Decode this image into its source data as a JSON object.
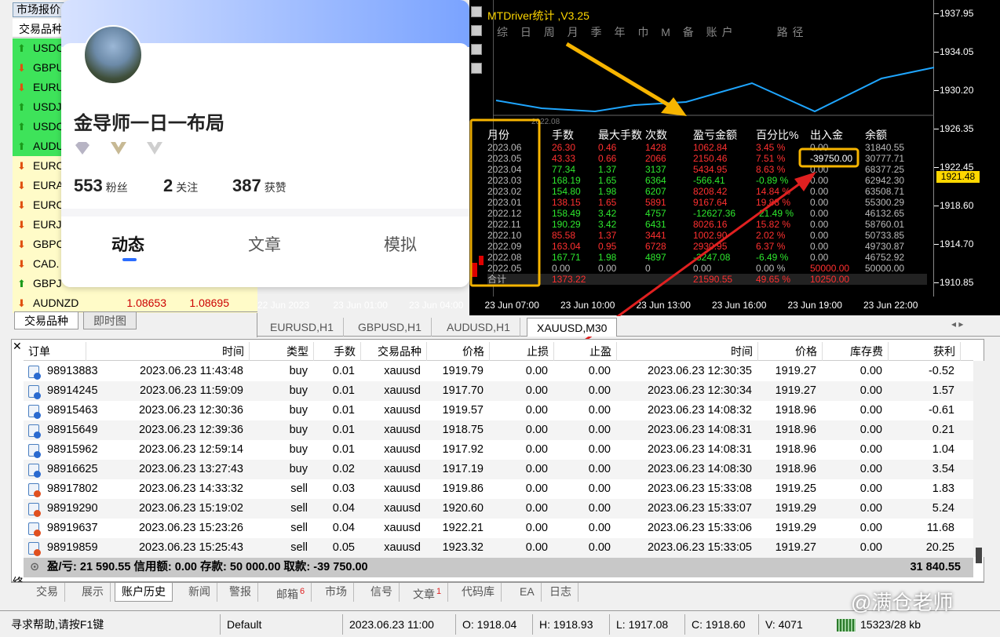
{
  "market_watch": {
    "title": "市场报价",
    "column_symbol": "交易品种",
    "rows": [
      {
        "symbol": "USDC",
        "dir": "up",
        "hl": "green"
      },
      {
        "symbol": "GBPU",
        "dir": "down",
        "hl": "green"
      },
      {
        "symbol": "EURU",
        "dir": "down",
        "hl": "green"
      },
      {
        "symbol": "USDJ",
        "dir": "up",
        "hl": "green"
      },
      {
        "symbol": "USDC",
        "dir": "up",
        "hl": "green"
      },
      {
        "symbol": "AUDU",
        "dir": "up",
        "hl": "green"
      },
      {
        "symbol": "EURC",
        "dir": "down",
        "hl": "yellow"
      },
      {
        "symbol": "EURA",
        "dir": "down",
        "hl": "yellow"
      },
      {
        "symbol": "EURC",
        "dir": "down",
        "hl": "yellow"
      },
      {
        "symbol": "EURJ",
        "dir": "down",
        "hl": "yellow"
      },
      {
        "symbol": "GBPC",
        "dir": "down",
        "hl": "yellow"
      },
      {
        "symbol": "CAD.",
        "dir": "down",
        "hl": "yellow"
      },
      {
        "symbol": "GBPJ",
        "dir": "up",
        "hl": "yellow"
      },
      {
        "symbol": "AUDNZD",
        "dir": "down",
        "hl": "yellow",
        "bid": "1.08653",
        "ask": "1.08695"
      }
    ],
    "tabs": [
      "交易品种",
      "即时图"
    ]
  },
  "chart": {
    "title": "MTDriver统计 ,V3.25",
    "periods": "综 日 周 月 季 年 巾 M 备 账户",
    "route": "路径",
    "prices": [
      "1937.95",
      "1934.05",
      "1930.20",
      "1926.35",
      "1922.45",
      "1918.60",
      "1914.70",
      "1910.85"
    ],
    "current_price": "1921.48",
    "times": [
      "22 Jun 2023",
      "23 Jun 01:00",
      "23 Jun 04:00",
      "23 Jun 07:00",
      "23 Jun 10:00",
      "23 Jun 13:00",
      "23 Jun 16:00",
      "23 Jun 19:00",
      "23 Jun 22:00"
    ],
    "date_label": "2022.08",
    "stats_headers": [
      "月份",
      "手数",
      "最大手数",
      "次数",
      "盈亏金额",
      "百分比%",
      "出入金",
      "余额"
    ],
    "stats_rows": [
      [
        "2023.06",
        "26.30",
        "0.46",
        "1428",
        "1062.84",
        "3.45 %",
        "0.00",
        "31840.55"
      ],
      [
        "2023.05",
        "43.33",
        "0.66",
        "2066",
        "2150.46",
        "7.51 %",
        "-39750.00",
        "30777.71"
      ],
      [
        "2023.04",
        "77.34",
        "1.37",
        "3137",
        "5434.95",
        "8.63 %",
        "0.00",
        "68377.25"
      ],
      [
        "2023.03",
        "168.19",
        "1.65",
        "6364",
        "-566.41",
        "-0.89 %",
        "0.00",
        "62942.30"
      ],
      [
        "2023.02",
        "154.80",
        "1.98",
        "6207",
        "8208.42",
        "14.84 %",
        "0.00",
        "63508.71"
      ],
      [
        "2023.01",
        "138.15",
        "1.65",
        "5891",
        "9167.64",
        "19.88 %",
        "0.00",
        "55300.29"
      ],
      [
        "2022.12",
        "158.49",
        "3.42",
        "4757",
        "-12627.36",
        "-21.49 %",
        "0.00",
        "46132.65"
      ],
      [
        "2022.11",
        "190.29",
        "3.42",
        "6431",
        "8026.16",
        "15.82 %",
        "0.00",
        "58760.01"
      ],
      [
        "2022.10",
        "85.58",
        "1.37",
        "3441",
        "1002.90",
        "2.02 %",
        "0.00",
        "50733.85"
      ],
      [
        "2022.09",
        "163.04",
        "0.95",
        "6728",
        "2930.95",
        "6.37 %",
        "0.00",
        "49730.87"
      ],
      [
        "2022.08",
        "167.71",
        "1.98",
        "4897",
        "-3247.08",
        "-6.49 %",
        "0.00",
        "46752.92"
      ],
      [
        "2022.05",
        "0.00",
        "0.00",
        "0",
        "0.00",
        "0.00 %",
        "50000.00",
        "50000.00"
      ]
    ],
    "stats_total": [
      "合计",
      "1373.22",
      "",
      "",
      "21590.55",
      "49.65 %",
      "10250.00",
      ""
    ]
  },
  "symbol_tabs": [
    "EURUSD,H1",
    "GBPUSD,H1",
    "AUDUSD,H1",
    "XAUUSD,M30"
  ],
  "terminal": {
    "headers": [
      "订单",
      "时间",
      "类型",
      "手数",
      "交易品种",
      "价格",
      "止损",
      "止盈",
      "时间",
      "价格",
      "库存费",
      "获利"
    ],
    "rows": [
      [
        "98913883",
        "2023.06.23 11:43:48",
        "buy",
        "0.01",
        "xauusd",
        "1919.79",
        "0.00",
        "0.00",
        "2023.06.23 12:30:35",
        "1919.27",
        "0.00",
        "-0.52"
      ],
      [
        "98914245",
        "2023.06.23 11:59:09",
        "buy",
        "0.01",
        "xauusd",
        "1917.70",
        "0.00",
        "0.00",
        "2023.06.23 12:30:34",
        "1919.27",
        "0.00",
        "1.57"
      ],
      [
        "98915463",
        "2023.06.23 12:30:36",
        "buy",
        "0.01",
        "xauusd",
        "1919.57",
        "0.00",
        "0.00",
        "2023.06.23 14:08:32",
        "1918.96",
        "0.00",
        "-0.61"
      ],
      [
        "98915649",
        "2023.06.23 12:39:36",
        "buy",
        "0.01",
        "xauusd",
        "1918.75",
        "0.00",
        "0.00",
        "2023.06.23 14:08:31",
        "1918.96",
        "0.00",
        "0.21"
      ],
      [
        "98915962",
        "2023.06.23 12:59:14",
        "buy",
        "0.01",
        "xauusd",
        "1917.92",
        "0.00",
        "0.00",
        "2023.06.23 14:08:31",
        "1918.96",
        "0.00",
        "1.04"
      ],
      [
        "98916625",
        "2023.06.23 13:27:43",
        "buy",
        "0.02",
        "xauusd",
        "1917.19",
        "0.00",
        "0.00",
        "2023.06.23 14:08:30",
        "1918.96",
        "0.00",
        "3.54"
      ],
      [
        "98917802",
        "2023.06.23 14:33:32",
        "sell",
        "0.03",
        "xauusd",
        "1919.86",
        "0.00",
        "0.00",
        "2023.06.23 15:33:08",
        "1919.25",
        "0.00",
        "1.83"
      ],
      [
        "98919290",
        "2023.06.23 15:19:02",
        "sell",
        "0.04",
        "xauusd",
        "1920.60",
        "0.00",
        "0.00",
        "2023.06.23 15:33:07",
        "1919.29",
        "0.00",
        "5.24"
      ],
      [
        "98919637",
        "2023.06.23 15:23:26",
        "sell",
        "0.04",
        "xauusd",
        "1922.21",
        "0.00",
        "0.00",
        "2023.06.23 15:33:06",
        "1919.29",
        "0.00",
        "11.68"
      ],
      [
        "98919859",
        "2023.06.23 15:25:43",
        "sell",
        "0.05",
        "xauusd",
        "1923.32",
        "0.00",
        "0.00",
        "2023.06.23 15:33:05",
        "1919.27",
        "0.00",
        "20.25"
      ]
    ],
    "total_text": "盈/亏: 21 590.55  信用额: 0.00  存款: 50 000.00  取款: -39 750.00",
    "total_balance": "31 840.55"
  },
  "bottom_tabs": [
    "交易",
    "展示",
    "账户历史",
    "新闻",
    "警报",
    "邮箱",
    "市场",
    "信号",
    "文章",
    "代码库",
    "EA",
    "日志"
  ],
  "badges": {
    "mail": "6",
    "article": "1"
  },
  "side_label": "终端",
  "status": {
    "help": "寻求帮助,请按F1键",
    "profile": "Default",
    "time": "2023.06.23 11:00",
    "open": "O: 1918.04",
    "high": "H: 1918.93",
    "low": "L: 1917.08",
    "close": "C: 1918.60",
    "volume": "V: 4071",
    "traffic": "15323/28 kb"
  },
  "card": {
    "name": "金导师一日一布局",
    "fans": "553",
    "fans_label": "粉丝",
    "follow": "2",
    "follow_label": "关注",
    "likes": "387",
    "likes_label": "获赞",
    "tabs": [
      "动态",
      "文章",
      "模拟"
    ]
  },
  "watermark": "@满仓老师"
}
